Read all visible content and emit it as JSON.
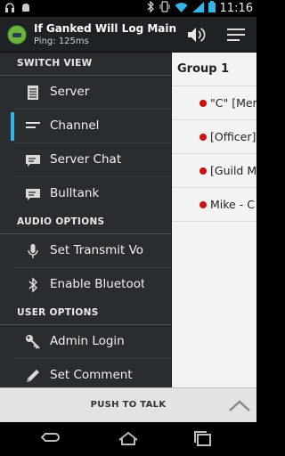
{
  "status_bar": {
    "time": "11:16",
    "left_icons": [
      "headset-icon",
      "android-icon"
    ],
    "right_icons": [
      "bluetooth-icon",
      "vibrate-icon",
      "wifi-icon",
      "signal-icon",
      "battery-icon"
    ]
  },
  "action_bar": {
    "title": "If Ganked Will Log Main",
    "subtitle": "Ping: 125ms"
  },
  "drawer": {
    "sections": [
      {
        "header": "SWITCH VIEW"
      },
      {
        "header": "AUDIO OPTIONS"
      },
      {
        "header": "USER OPTIONS"
      }
    ],
    "items": [
      {
        "label": "Server",
        "icon": "list-icon",
        "active": false
      },
      {
        "label": "Channel",
        "icon": "channel-icon",
        "active": true
      },
      {
        "label": "Server Chat",
        "icon": "chat-icon",
        "active": false
      },
      {
        "label": "Bulltank",
        "icon": "chat-icon",
        "active": false
      },
      {
        "label": "Set Transmit Volume",
        "icon": "microphone-icon",
        "active": false
      },
      {
        "label": "Enable Bluetooth",
        "icon": "bluetooth-icon",
        "active": false
      },
      {
        "label": "Admin Login",
        "icon": "key-icon",
        "active": false
      },
      {
        "label": "Set Comment",
        "icon": "pencil-icon",
        "active": false
      }
    ]
  },
  "content": {
    "group": "Group 1",
    "users": [
      {
        "name": "\"C\" [Mer",
        "status_color": "#cc1010"
      },
      {
        "name": "[Officer]",
        "status_color": "#cc1010"
      },
      {
        "name": "[Guild M",
        "status_color": "#cc1010"
      },
      {
        "name": "Mike - C",
        "status_color": "#cc1010"
      }
    ]
  },
  "push_to_talk": {
    "label": "PUSH TO TALK"
  },
  "colors": {
    "accent": "#33b5e5",
    "drawer_bg": "#2a2d30",
    "status_dot": "#cc1010"
  }
}
